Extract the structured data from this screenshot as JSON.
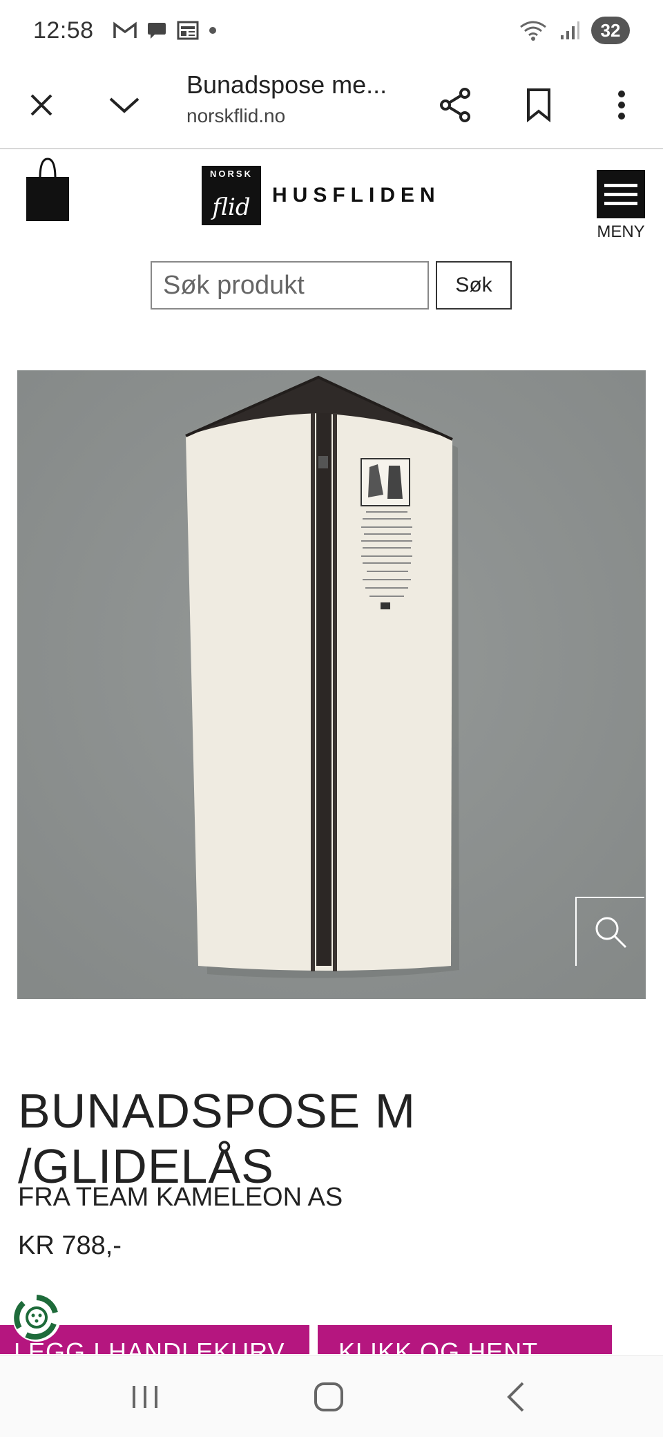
{
  "status_bar": {
    "time": "12:58",
    "battery": "32",
    "left_icons": [
      "gmail-icon",
      "chat-icon",
      "news-icon",
      "dot-icon"
    ],
    "right_icons": [
      "wifi-icon",
      "signal-icon"
    ]
  },
  "browser": {
    "page_title": "Bunadspose me...",
    "url": "norskflid.no",
    "buttons": [
      "close-icon",
      "chevron-down-icon",
      "share-icon",
      "bookmark-icon",
      "more-vert-icon"
    ]
  },
  "header": {
    "logo_box_top": "NORSK",
    "logo_box_bottom": "flid",
    "logo_text": "HUSFLIDEN",
    "menu_label": "MENY"
  },
  "search": {
    "placeholder": "Søk produkt",
    "button_label": "Søk"
  },
  "product": {
    "title": "BUNADSPOSE M /GLIDELÅS",
    "vendor": "FRA TEAM KAMELEON AS",
    "price": "KR 788,-",
    "add_to_cart_label": "LEGG I HANDLEKURV",
    "click_collect_label": "KLIKK OG HENT"
  },
  "colors": {
    "accent": "#b5167f",
    "image_bg": "#8a8e8d",
    "garment_bag": "#efebe1"
  }
}
